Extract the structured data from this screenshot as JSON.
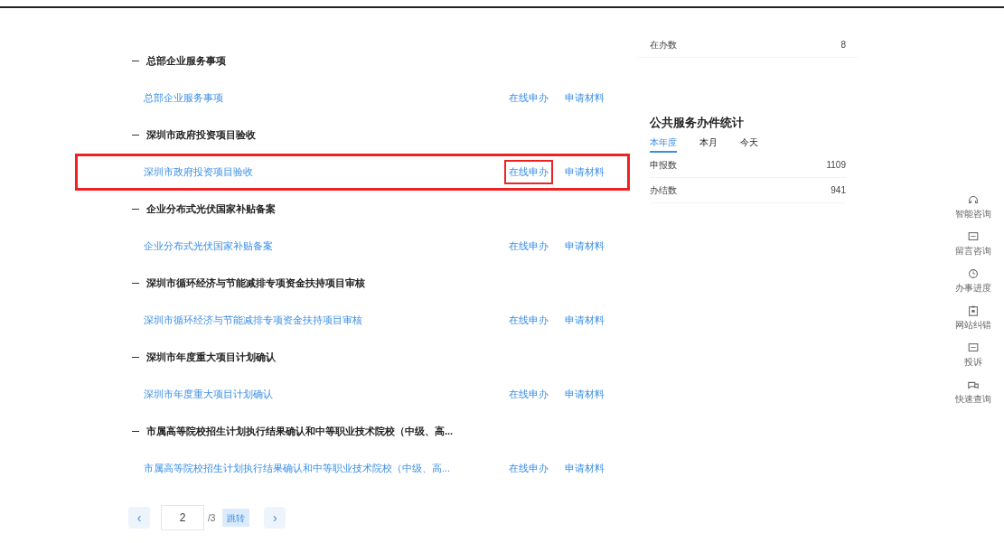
{
  "groups": [
    {
      "title": "总部企业服务事项",
      "items": [
        {
          "name": "总部企业服务事项",
          "actions": [
            {
              "label": "在线申办",
              "highlighted": false
            },
            {
              "label": "申请材料",
              "highlighted": false
            }
          ],
          "highlighted": false
        }
      ]
    },
    {
      "title": "深圳市政府投资项目验收",
      "items": [
        {
          "name": "深圳市政府投资项目验收",
          "actions": [
            {
              "label": "在线申办",
              "highlighted": true
            },
            {
              "label": "申请材料",
              "highlighted": false
            }
          ],
          "highlighted": true
        }
      ]
    },
    {
      "title": "企业分布式光伏国家补贴备案",
      "items": [
        {
          "name": "企业分布式光伏国家补贴备案",
          "actions": [
            {
              "label": "在线申办",
              "highlighted": false
            },
            {
              "label": "申请材料",
              "highlighted": false
            }
          ],
          "highlighted": false
        }
      ]
    },
    {
      "title": "深圳市循环经济与节能减排专项资金扶持项目审核",
      "items": [
        {
          "name": "深圳市循环经济与节能减排专项资金扶持项目审核",
          "actions": [
            {
              "label": "在线申办",
              "highlighted": false
            },
            {
              "label": "申请材料",
              "highlighted": false
            }
          ],
          "highlighted": false
        }
      ]
    },
    {
      "title": "深圳市年度重大项目计划确认",
      "items": [
        {
          "name": "深圳市年度重大项目计划确认",
          "actions": [
            {
              "label": "在线申办",
              "highlighted": false
            },
            {
              "label": "申请材料",
              "highlighted": false
            }
          ],
          "highlighted": false
        }
      ]
    },
    {
      "title": "市属高等院校招生计划执行结果确认和中等职业技术院校（中级、高...",
      "items": [
        {
          "name": "市属高等院校招生计划执行结果确认和中等职业技术院校（中级、高...",
          "actions": [
            {
              "label": "在线申办",
              "highlighted": false
            },
            {
              "label": "申请材料",
              "highlighted": false
            }
          ],
          "highlighted": false
        }
      ]
    }
  ],
  "pagination": {
    "prev": "‹",
    "page": "2",
    "total": "/3",
    "jump": "跳转",
    "next": "›"
  },
  "stats_top": [
    {
      "label": "在办数",
      "value": "8"
    }
  ],
  "public_stats": {
    "title": "公共服务办件统计",
    "tabs": [
      {
        "label": "本年度",
        "selected": true
      },
      {
        "label": "本月",
        "selected": false
      },
      {
        "label": "今天",
        "selected": false
      }
    ],
    "rows": [
      {
        "label": "申报数",
        "value": "1109"
      },
      {
        "label": "办结数",
        "value": "941"
      }
    ]
  },
  "side_tools": [
    {
      "kind": "headset",
      "label": "智能咨询"
    },
    {
      "kind": "message",
      "label": "留言咨询"
    },
    {
      "kind": "clock",
      "label": "办事进度"
    },
    {
      "kind": "clipboard",
      "label": "网站纠错"
    },
    {
      "kind": "message",
      "label": "投诉"
    },
    {
      "kind": "chat",
      "label": "快速查询"
    }
  ]
}
